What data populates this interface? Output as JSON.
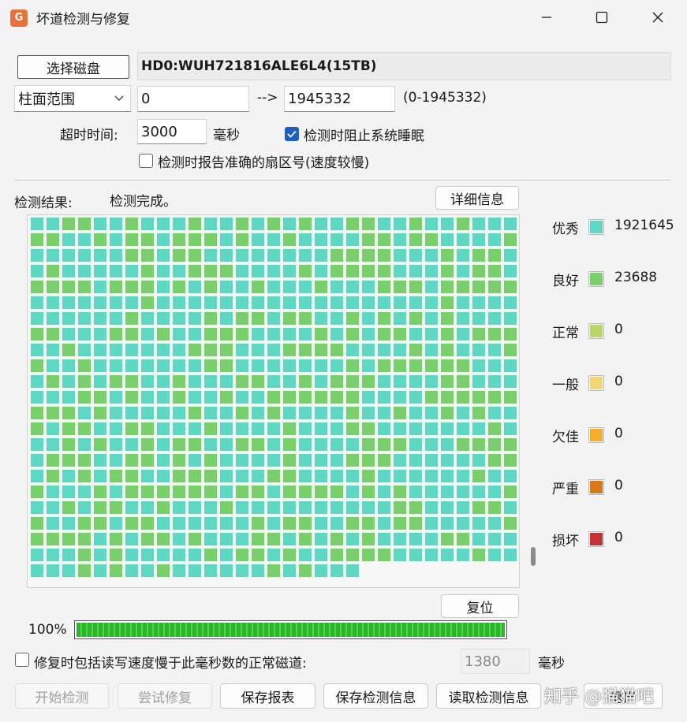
{
  "window": {
    "title": "坏道检测与修复",
    "app_icon": "G"
  },
  "disk": {
    "select_label": "选择磁盘",
    "name": "HD0:WUH721816ALE6L4(15TB)"
  },
  "range": {
    "mode": "柱面范围",
    "start": "0",
    "arrow": "-->",
    "end": "1945332",
    "limits": "(0-1945332)"
  },
  "timeout": {
    "label": "超时时间:",
    "value": "3000",
    "unit": "毫秒"
  },
  "options": {
    "prevent_sleep_label": "检测时阻止系统睡眠",
    "prevent_sleep_checked": true,
    "exact_sector_label": "检测时报告准确的扇区号(速度较慢)",
    "exact_sector_checked": false
  },
  "result": {
    "label": "检测结果:",
    "status": "检测完成。",
    "detail_label": "详细信息"
  },
  "legend": [
    {
      "label": "优秀",
      "count": "1921645",
      "color": "#5fd8c3"
    },
    {
      "label": "良好",
      "count": "23688",
      "color": "#79cf6c"
    },
    {
      "label": "正常",
      "count": "0",
      "color": "#b8d66a"
    },
    {
      "label": "一般",
      "count": "0",
      "color": "#f2d675"
    },
    {
      "label": "欠佳",
      "count": "0",
      "color": "#f4ad2c"
    },
    {
      "label": "严重",
      "count": "0",
      "color": "#d97a18"
    },
    {
      "label": "损坏",
      "count": "0",
      "color": "#c43238"
    }
  ],
  "reset_label": "复位",
  "progress": {
    "text": "100%",
    "value": 1.0
  },
  "slow_repair": {
    "label": "修复时包括读写速度慢于此毫秒数的正常磁道:",
    "value": "1380",
    "unit": "毫秒",
    "checked": false
  },
  "buttons": {
    "start": "开始检测",
    "repair": "尝试修复",
    "save_report": "保存报表",
    "save_info": "保存检测信息",
    "load_info": "读取检测信息",
    "exit": "退出"
  },
  "watermark": "知乎 @猫猫吧"
}
